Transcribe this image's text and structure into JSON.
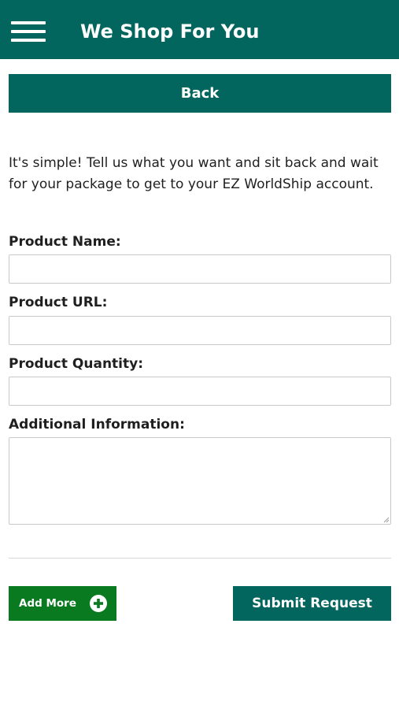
{
  "header": {
    "title": "We Shop For You",
    "menu_icon": "hamburger-menu-icon"
  },
  "nav": {
    "back_label": "Back"
  },
  "intro_text": "It's simple! Tell us what you want and sit back and wait for your package to get to your EZ WorldShip account.",
  "form": {
    "product_name": {
      "label": "Product Name:",
      "value": ""
    },
    "product_url": {
      "label": "Product URL:",
      "value": ""
    },
    "product_quantity": {
      "label": "Product Quantity:",
      "value": ""
    },
    "additional_info": {
      "label": "Additional Information:",
      "value": ""
    }
  },
  "actions": {
    "add_more_label": "Add More",
    "add_more_icon": "plus-circle-icon",
    "submit_label": "Submit Request"
  },
  "colors": {
    "primary_teal": "#02665e",
    "add_more_green": "#0a7a20",
    "border_gray": "#c8c8c8"
  }
}
